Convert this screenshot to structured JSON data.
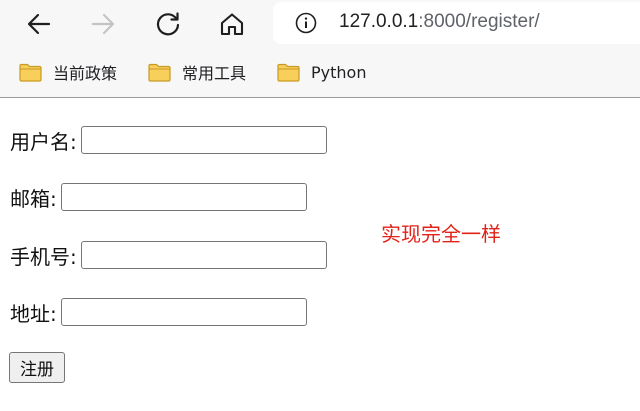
{
  "browser": {
    "url_host": "127.0.0.1",
    "url_rest": ":8000/register/",
    "icons": [
      "back-arrow-icon",
      "forward-arrow-icon",
      "reload-icon",
      "home-icon",
      "info-icon",
      "folder-icon"
    ]
  },
  "bookmarks": [
    {
      "label": "当前政策"
    },
    {
      "label": "常用工具"
    },
    {
      "label": "Python"
    }
  ],
  "form": {
    "fields": [
      {
        "label": "用户名:",
        "value": ""
      },
      {
        "label": "邮箱:",
        "value": ""
      },
      {
        "label": "手机号:",
        "value": ""
      },
      {
        "label": "地址:",
        "value": ""
      }
    ],
    "submit_label": "注册"
  },
  "annotation": {
    "text": "实现完全一样",
    "color": "#e2231a"
  }
}
